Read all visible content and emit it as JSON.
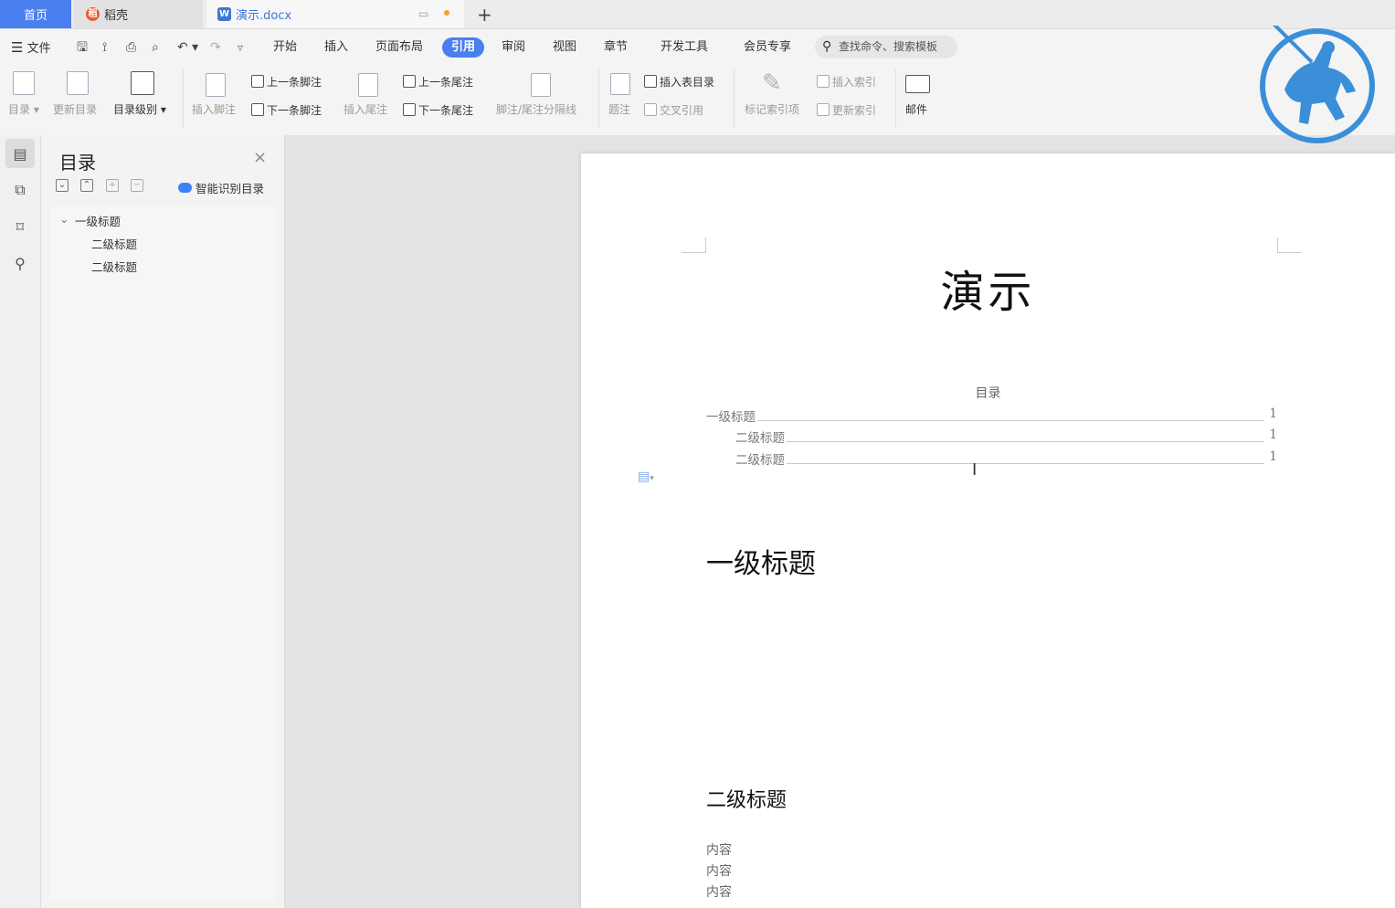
{
  "tabs": {
    "home": "首页",
    "daoke": "稻壳",
    "doc": "演示.docx",
    "add": "+"
  },
  "menu": {
    "file": "文件",
    "items": [
      "开始",
      "插入",
      "页面布局",
      "引用",
      "审阅",
      "视图",
      "章节",
      "开发工具",
      "会员专享"
    ],
    "active": "引用",
    "search_placeholder": "查找命令、搜索模板"
  },
  "ribbon": {
    "toc": "目录",
    "update_toc": "更新目录",
    "toc_level": "目录级别",
    "insert_footnote": "插入脚注",
    "prev_footnote": "上一条脚注",
    "next_footnote": "下一条脚注",
    "insert_endnote": "插入尾注",
    "prev_endnote": "上一条尾注",
    "next_endnote": "下一条尾注",
    "separator": "脚注/尾注分隔线",
    "caption": "题注",
    "insert_table_toc": "插入表目录",
    "cross_ref": "交叉引用",
    "mark_index": "标记索引项",
    "insert_index": "插入索引",
    "update_index": "更新索引",
    "mail": "邮件"
  },
  "nav": {
    "title": "目录",
    "smart": "智能识别目录",
    "items": [
      {
        "label": "一级标题",
        "level": 1
      },
      {
        "label": "二级标题",
        "level": 2
      },
      {
        "label": "二级标题",
        "level": 2
      }
    ]
  },
  "document": {
    "title": "演示",
    "toc_heading": "目录",
    "toc": [
      {
        "label": "一级标题",
        "page": "1"
      },
      {
        "label": "二级标题",
        "page": "1"
      },
      {
        "label": "二级标题",
        "page": "1"
      }
    ],
    "h1": "一级标题",
    "h2": "二级标题",
    "paragraphs": [
      "内容",
      "内容",
      "内容"
    ]
  },
  "colors": {
    "accent": "#4a7ff0",
    "logo": "#3a8fd8"
  }
}
